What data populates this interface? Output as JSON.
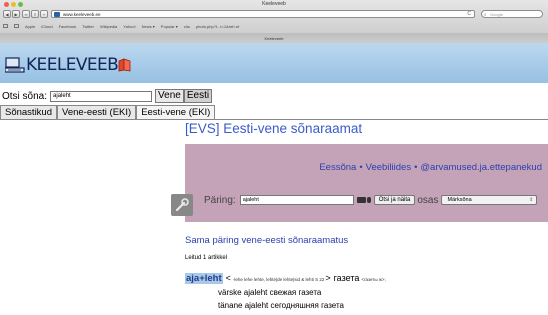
{
  "window": {
    "title": "Keeleveeb",
    "url": "www.keeleveeb.ee",
    "tab_title": "Keeleveeb",
    "search_placeholder": "Google"
  },
  "bookmarks": [
    "Apple",
    "iCloud",
    "Facebook",
    "Twitter",
    "Wikipedia",
    "Yahoo!",
    "News ▾",
    "Popular ▾",
    "chs",
    "photo.php?f...t=1&ref=nf"
  ],
  "site": {
    "logo_text": "KEELEVEEB",
    "query_label": "Otsi sõna:",
    "query_value": "ajaleht",
    "lang_buttons": [
      "Vene",
      "Eesti"
    ]
  },
  "dict_tabs": [
    "Sõnastikud",
    "Vene-eesti (EKI)",
    "Eesti-vene (EKI)"
  ],
  "dictionary": {
    "title": "[EVS] Eesti-vene sõnaraamat",
    "links": [
      "Eessõna",
      "Veebiliides",
      "@arvamused.ja.ettepanekud"
    ],
    "paring_label": "Päring:",
    "paring_value": "ajaleht",
    "show_button": "Otsi ja näita",
    "osas_label": "osas",
    "osas_value": "Märksõna"
  },
  "results": {
    "same_query_link": "Sama päring vene-eesti sõnaraamatus",
    "found_text": "Leitud 1 artikkel",
    "headword": "aja+leht",
    "lt": "<",
    "forms": "-lehe lehe lehte, lehte|de lehte|sid & lehti S 22",
    "gt": ">",
    "translation": "газета",
    "translation_note": "<газеты ж>;",
    "examples": [
      "värske ajaleht свежая газета",
      "tänane ajaleht сегодняшняя газета"
    ]
  }
}
